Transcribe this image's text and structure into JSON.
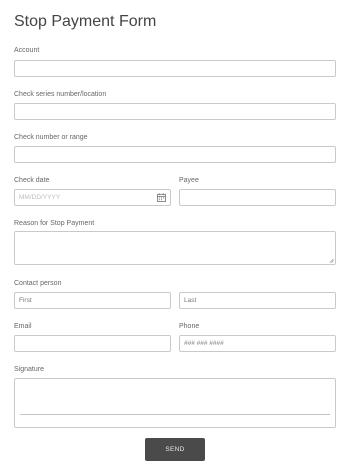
{
  "form": {
    "title": "Stop Payment Form",
    "account": {
      "label": "Account",
      "value": ""
    },
    "check_series": {
      "label": "Check series number/location",
      "value": ""
    },
    "check_number": {
      "label": "Check number or range",
      "value": ""
    },
    "check_date": {
      "label": "Check date",
      "placeholder": "MM/DD/YYYY",
      "icon": "calendar-icon"
    },
    "payee": {
      "label": "Payee",
      "value": ""
    },
    "reason": {
      "label": "Reason for Stop Payment",
      "value": ""
    },
    "contact_person": {
      "label": "Contact person",
      "first_placeholder": "First",
      "last_placeholder": "Last"
    },
    "email": {
      "label": "Email",
      "value": ""
    },
    "phone": {
      "label": "Phone",
      "placeholder": "### ### ####"
    },
    "signature": {
      "label": "Signature"
    },
    "send_label": "SEND"
  },
  "colors": {
    "button_bg": "#4a4a4a",
    "border": "#c9c9c9",
    "title": "#444444"
  }
}
